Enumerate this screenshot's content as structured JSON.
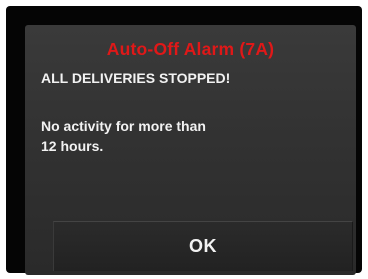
{
  "dialog": {
    "title": "Auto-Off Alarm (7A)",
    "headline": "ALL DELIVERIES STOPPED!",
    "message_lines": [
      "No activity for more than",
      "12 hours."
    ],
    "ok_label": "OK"
  },
  "colors": {
    "title": "#e01818",
    "text": "#f2f2f2",
    "panel": "#323232",
    "bezel": "#050505"
  }
}
